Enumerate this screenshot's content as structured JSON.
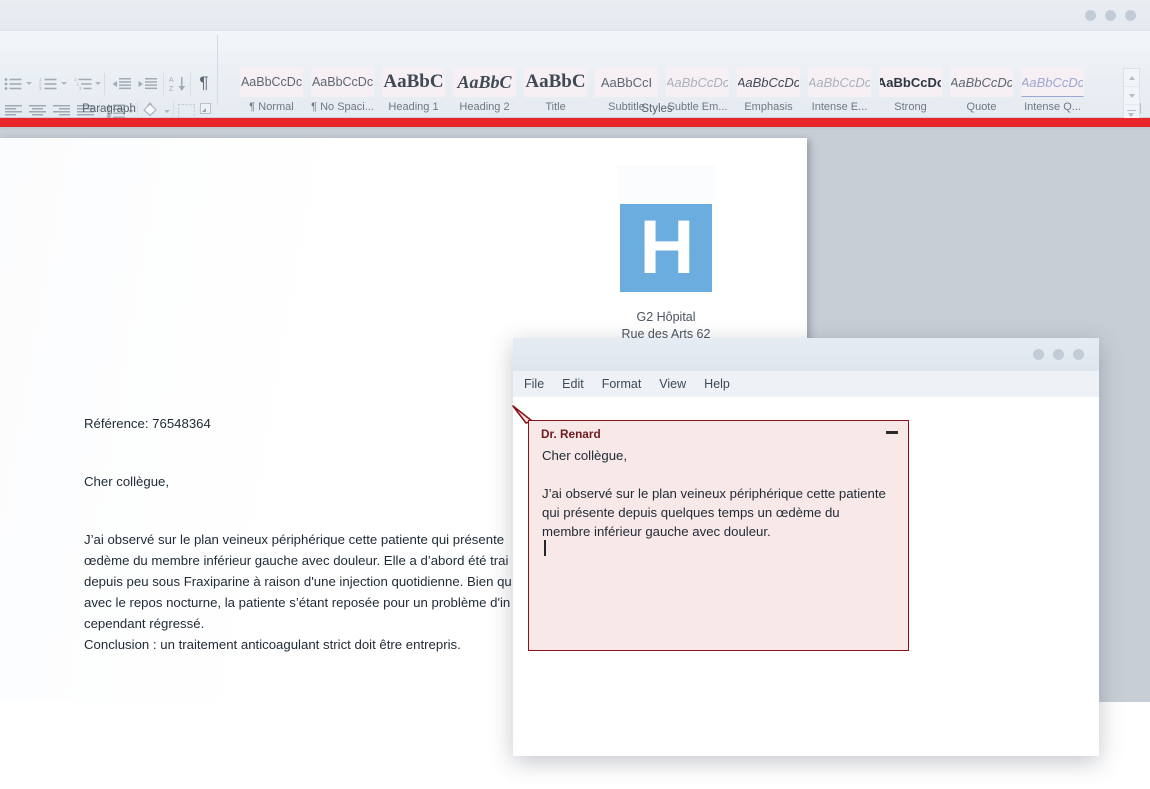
{
  "window": {
    "controls": [
      "minimize-dot",
      "maximize-dot",
      "close-dot"
    ]
  },
  "ribbon": {
    "groups": [
      {
        "id": "paragraph",
        "label": "Paragraph"
      },
      {
        "id": "styles",
        "label": "Styles"
      }
    ],
    "paragraph_tools_row1": [
      {
        "name": "bullet-list-icon"
      },
      {
        "name": "numbered-list-icon"
      },
      {
        "name": "multilevel-list-icon"
      },
      {
        "name": "decrease-indent-icon"
      },
      {
        "name": "increase-indent-icon"
      },
      {
        "name": "sort-icon"
      },
      {
        "name": "show-formatting-marks-icon",
        "glyph": "¶"
      }
    ],
    "paragraph_tools_row2": [
      {
        "name": "align-left-icon"
      },
      {
        "name": "align-center-icon"
      },
      {
        "name": "align-right-icon"
      },
      {
        "name": "justify-icon"
      },
      {
        "name": "line-spacing-icon"
      },
      {
        "name": "shading-icon"
      },
      {
        "name": "borders-icon"
      }
    ],
    "styles": [
      {
        "preview": "AaBbCcDc",
        "name": "¶ Normal",
        "cls": "sp-normal"
      },
      {
        "preview": "AaBbCcDc",
        "name": "¶ No Spaci...",
        "cls": "sp-nospace"
      },
      {
        "preview": "AaBbC",
        "name": "Heading 1",
        "cls": "sp-h1"
      },
      {
        "preview": "AaBbC",
        "name": "Heading 2",
        "cls": "sp-h2"
      },
      {
        "preview": "AaBbC",
        "name": "Title",
        "cls": "sp-title"
      },
      {
        "preview": "AaBbCcI",
        "name": "Subtitle",
        "cls": "sp-subtitle"
      },
      {
        "preview": "AaBbCcDc",
        "name": "Subtle Em...",
        "cls": "sp-subem"
      },
      {
        "preview": "AaBbCcDc",
        "name": "Emphasis",
        "cls": "sp-em"
      },
      {
        "preview": "AaBbCcDc",
        "name": "Intense E...",
        "cls": "sp-intem"
      },
      {
        "preview": "AaBbCcDc",
        "name": "Strong",
        "cls": "sp-strong"
      },
      {
        "preview": "AaBbCcDc",
        "name": "Quote",
        "cls": "sp-quote"
      },
      {
        "preview": "AaBbCcDc",
        "name": "Intense Q...",
        "cls": "sp-intq"
      }
    ]
  },
  "colors": {
    "accent_red_bar": "#e8252a",
    "logo_blue": "#6aadde",
    "comment_border": "#8a1119",
    "comment_background": "#f8e8e8",
    "chrome_blue_grey": "#e4e9ef"
  },
  "document": {
    "logo": {
      "letter": "H"
    },
    "letterhead_line1": "G2 Hôpital",
    "letterhead_line2": "Rue des Arts 62",
    "reference": "Référence: 76548364",
    "salutation": "Cher collègue,",
    "body": "J’ai observé sur le plan veineux périphérique cette patiente qui présente\nœdème du membre inférieur gauche avec douleur. Elle a d’abord été trai\ndepuis peu sous Fraxiparine à raison d'une injection quotidienne. Bien qu\navec le repos nocturne, la patiente s’étant reposée pour un problème d'in\ncependant régressé.",
    "conclusion": "Conclusion : un traitement anticoagulant strict doit être entrepris."
  },
  "popup": {
    "menu": [
      {
        "label": "File"
      },
      {
        "label": "Edit"
      },
      {
        "label": "Format"
      },
      {
        "label": "View"
      },
      {
        "label": "Help"
      }
    ],
    "comment": {
      "author": "Dr. Renard",
      "minimize_label": "−",
      "text": "Cher collègue,\n\nJ’ai observé sur le plan veineux périphérique cette patiente\nqui présente depuis quelques temps un œdème du\nmembre inférieur gauche avec douleur."
    }
  }
}
